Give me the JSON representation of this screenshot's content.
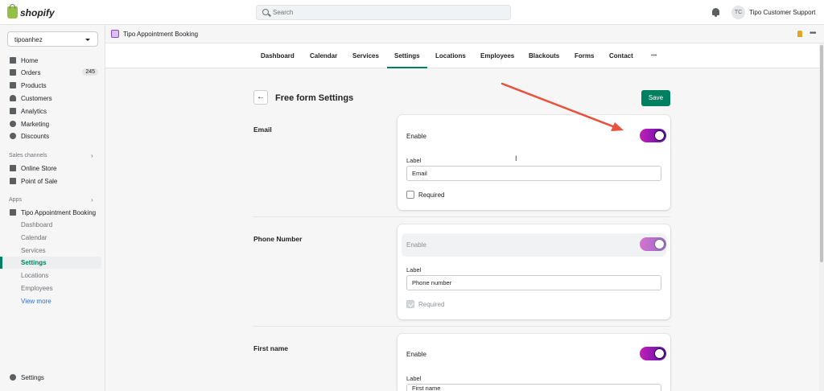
{
  "topbar": {
    "logo_text": "shopify",
    "search_placeholder": "Search",
    "avatar_initials": "TC",
    "user_name": "Tipo Customer Support"
  },
  "sidebar": {
    "store_name": "tipoanhez",
    "items": [
      {
        "label": "Home",
        "icon": "home-icon"
      },
      {
        "label": "Orders",
        "icon": "orders-icon",
        "badge": "245"
      },
      {
        "label": "Products",
        "icon": "tag-icon"
      },
      {
        "label": "Customers",
        "icon": "person-icon"
      },
      {
        "label": "Analytics",
        "icon": "chart-icon"
      },
      {
        "label": "Marketing",
        "icon": "target-icon"
      },
      {
        "label": "Discounts",
        "icon": "discount-icon"
      }
    ],
    "sales_channels_label": "Sales channels",
    "sales_channels": [
      {
        "label": "Online Store",
        "icon": "store-icon"
      },
      {
        "label": "Point of Sale",
        "icon": "pos-icon"
      }
    ],
    "apps_label": "Apps",
    "app_name": "Tipo Appointment Booking",
    "app_subitems": [
      "Dashboard",
      "Calendar",
      "Services",
      "Settings",
      "Locations",
      "Employees"
    ],
    "view_more": "View more",
    "settings_label": "Settings"
  },
  "appbar": {
    "title": "Tipo Appointment Booking"
  },
  "tabs": [
    "Dashboard",
    "Calendar",
    "Services",
    "Settings",
    "Locations",
    "Employees",
    "Blackouts",
    "Forms",
    "Contact",
    "•••"
  ],
  "active_tab": "Settings",
  "page": {
    "title": "Free form Settings",
    "save_label": "Save",
    "back_icon": "←"
  },
  "sections": [
    {
      "title": "Email",
      "enable_label": "Enable",
      "enabled": true,
      "toggle_disabled": false,
      "label_caption": "Label",
      "label_value": "Email",
      "required_label": "Required",
      "required": false,
      "required_disabled": false
    },
    {
      "title": "Phone Number",
      "enable_label": "Enable",
      "enabled": true,
      "toggle_disabled": true,
      "label_caption": "Label",
      "label_value": "Phone number",
      "required_label": "Required",
      "required": true,
      "required_disabled": true
    },
    {
      "title": "First name",
      "enable_label": "Enable",
      "enabled": true,
      "toggle_disabled": false,
      "label_caption": "Label",
      "label_value": "First name"
    }
  ],
  "colors": {
    "accent_green": "#008060",
    "toggle_gradient_start": "#c41fb8",
    "toggle_gradient_end": "#5a11a5",
    "annotation_arrow": "#e8533f"
  }
}
